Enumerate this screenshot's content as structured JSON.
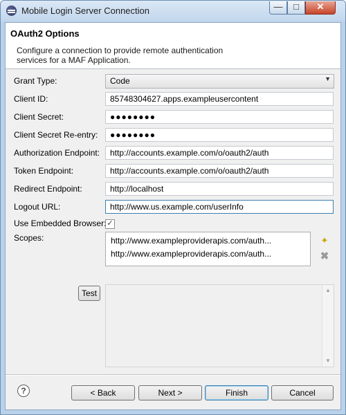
{
  "window": {
    "title": "Mobile Login Server Connection",
    "minimize": "—",
    "maximize": "□",
    "close": "✕"
  },
  "header": {
    "title": "OAuth2 Options",
    "description": "Configure a connection to provide remote authentication services for a MAF Application."
  },
  "form": {
    "grant_type": {
      "label": "Grant Type:",
      "value": "Code"
    },
    "client_id": {
      "label": "Client ID:",
      "value": "85748304627.apps.exampleusercontent"
    },
    "client_secret": {
      "label": "Client Secret:",
      "value": "●●●●●●●●"
    },
    "client_secret_reentry": {
      "label": "Client Secret Re-entry:",
      "value": "●●●●●●●●"
    },
    "authorization_endpoint": {
      "label": "Authorization Endpoint:",
      "value": "http://accounts.example.com/o/oauth2/auth"
    },
    "token_endpoint": {
      "label": "Token Endpoint:",
      "value": "http://accounts.example.com/o/oauth2/auth"
    },
    "redirect_endpoint": {
      "label": "Redirect Endpoint:",
      "value": "http://localhost"
    },
    "logout_url": {
      "label": "Logout URL:",
      "value": "http://www.us.example.com/userInfo"
    },
    "use_embedded_browser": {
      "label": "Use Embedded Browser:",
      "checked": true,
      "mark": "✓"
    },
    "scopes": {
      "label": "Scopes:",
      "items": [
        "http://www.exampleproviderapis.com/auth...",
        "http://www.exampleproviderapis.com/auth..."
      ]
    }
  },
  "icons": {
    "add_scope": "✦",
    "remove_scope": "✖",
    "help": "?",
    "scroll_up": "▲",
    "scroll_down": "▼",
    "dropdown": "▼"
  },
  "test": {
    "button_label": "Test"
  },
  "footer": {
    "back_label": "< Back",
    "next_label": "Next >",
    "finish_label": "Finish",
    "cancel_label": "Cancel"
  }
}
